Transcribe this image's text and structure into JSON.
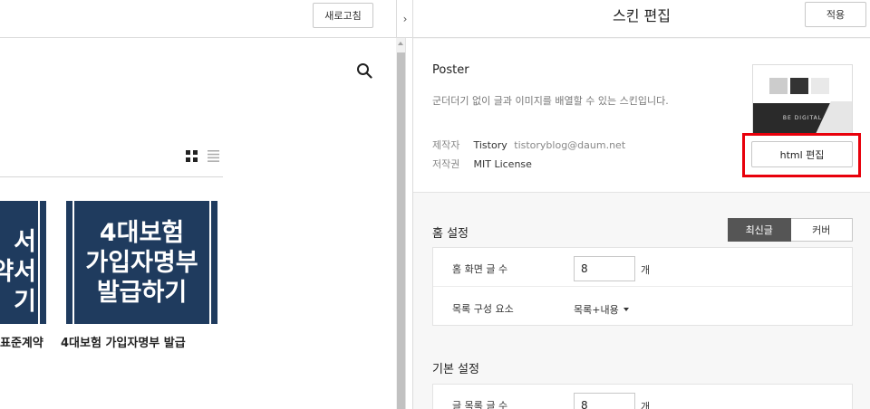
{
  "left_pane": {
    "refresh_label": "새로고침",
    "posts": [
      {
        "thumb_text": "서\n약서\n기",
        "title": "표준계약"
      },
      {
        "thumb_text": "4대보험\n가입자명부\n발급하기",
        "title": "4대보험 가입자명부 발급"
      }
    ]
  },
  "splitter": {
    "collapse_glyph": "›"
  },
  "editor": {
    "title": "스킨 편집",
    "apply_label": "적용",
    "skin": {
      "name": "Poster",
      "description": "군더더기 없이 글과 이미지를 배열할 수 있는 스킨입니다.",
      "author_label": "제작자",
      "author_name": "Tistory",
      "author_email": "tistoryblog@daum.net",
      "license_label": "저작권",
      "license_value": "MIT License",
      "thumbnail_caption": "BE DIGITAL",
      "html_edit_label": "html 편집",
      "highlight_color": "#e8000b"
    },
    "home_settings": {
      "title": "홈 설정",
      "toggle": [
        "최신글",
        "커버"
      ],
      "toggle_selected": "최신글",
      "post_count_label": "홈 화면 글 수",
      "post_count_value": "8",
      "post_count_unit": "개",
      "list_component_label": "목록 구성 요소",
      "list_component_value": "목록+내용"
    },
    "basic_settings": {
      "title": "기본 설정",
      "post_count_label": "글 목록 글 수",
      "post_count_value": "8",
      "post_count_unit": "개"
    }
  },
  "icons": {
    "search": "search-icon",
    "grid_view": "grid-view-icon",
    "list_view": "list-view-icon"
  }
}
